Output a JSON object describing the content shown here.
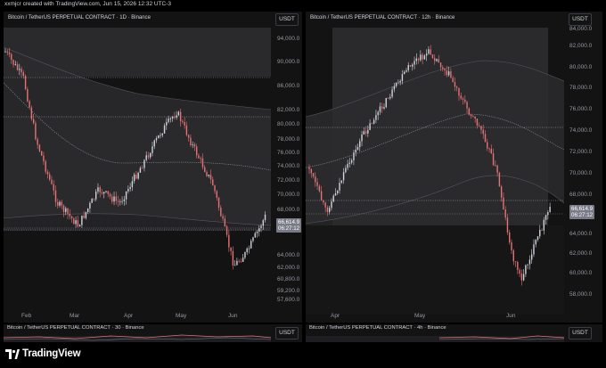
{
  "header": {
    "author_line": "xxmjcr created with TradingView.com, Jun 15, 2026 12:32 UTC-3"
  },
  "left_chart": {
    "title": "Bitcoin / TetherUS PERPETUAL CONTRACT · 1D · Binance",
    "currency_button": "USDT",
    "price_axis": [
      "94,000.0",
      "90,000.0",
      "86,000.0",
      "82,000.0",
      "80,000.0",
      "78,000.0",
      "76,000.0",
      "74,000.0",
      "72,000.0",
      "70,000.0",
      "68,000.0",
      "66,000.0",
      "64,000.0",
      "62,000.0",
      "60,800.0",
      "59,200.0",
      "57,600.0"
    ],
    "time_axis": [
      "Feb",
      "Mar",
      "Apr",
      "May",
      "Jun"
    ],
    "last_price": "66,614.9",
    "countdown": "06:27:12"
  },
  "right_chart": {
    "title": "Bitcoin / TetherUS PERPETUAL CONTRACT · 12h · Binance",
    "currency_button": "USDT",
    "price_axis": [
      "84,000.0",
      "82,000.0",
      "80,000.0",
      "78,000.0",
      "76,000.0",
      "74,000.0",
      "72,000.0",
      "70,000.0",
      "68,000.0",
      "64,000.0",
      "62,000.0",
      "60,000.0",
      "58,000.0"
    ],
    "time_axis": [
      "Apr",
      "May",
      "Jun"
    ],
    "last_price": "66,614.9",
    "countdown": "06:27:12"
  },
  "left_sub": {
    "title": "Bitcoin / TetherUS PERPETUAL CONTRACT · 30 · Binance",
    "currency_button": "USDT"
  },
  "right_sub": {
    "title": "Bitcoin / TetherUS PERPETUAL CONTRACT · 4h · Binance",
    "currency_button": "USDT"
  },
  "footer": {
    "brand": "TradingView"
  },
  "colors": {
    "up": "#d1d4dc",
    "down": "#e57373",
    "background": "#131313",
    "band": "#2a2a2d"
  }
}
